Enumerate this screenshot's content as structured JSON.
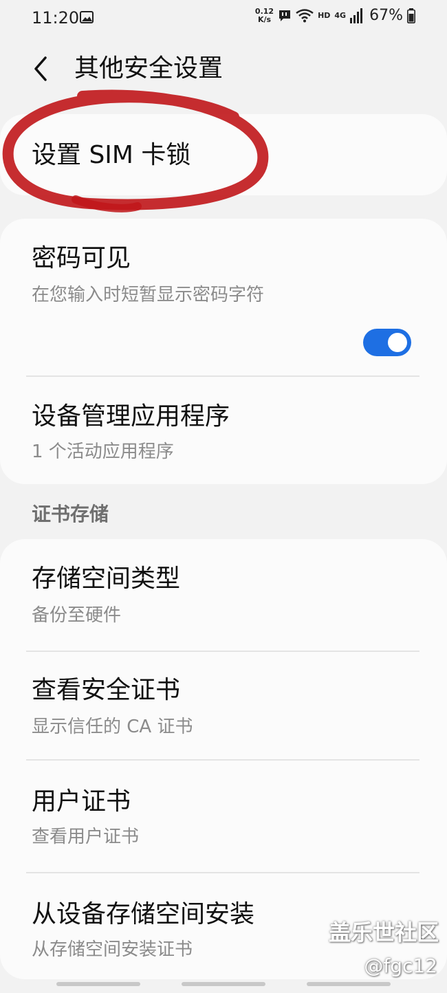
{
  "status_bar": {
    "time": "11:20",
    "net_speed_value": "0.12",
    "net_speed_unit": "K/s",
    "hd_label": "HD",
    "network_label": "4G",
    "battery": "67%",
    "icons": [
      "gallery-icon",
      "chat-icon",
      "wifi-icon",
      "signal-icon",
      "battery-icon"
    ]
  },
  "header": {
    "title": "其他安全设置"
  },
  "items": {
    "sim_lock": {
      "title": "设置 SIM 卡锁"
    },
    "password_visible": {
      "title": "密码可见",
      "subtitle": "在您输入时短暂显示密码字符",
      "toggle_on": true
    },
    "device_admin": {
      "title": "设备管理应用程序",
      "subtitle": "1 个活动应用程序"
    },
    "storage_type": {
      "title": "存储空间类型",
      "subtitle": "备份至硬件"
    },
    "view_certs": {
      "title": "查看安全证书",
      "subtitle": "显示信任的 CA 证书"
    },
    "user_certs": {
      "title": "用户证书",
      "subtitle": "查看用户证书"
    },
    "install_storage": {
      "title": "从设备存储空间安装",
      "subtitle": "从存储空间安装证书"
    }
  },
  "sections": {
    "cert_storage": "证书存储"
  },
  "watermark": {
    "site": "盖乐世社区",
    "handle": "@fgc12"
  },
  "colors": {
    "accent": "#1e6fe3",
    "annotation": "#c0161a",
    "background": "#f2f2f2",
    "card": "#fbfbfb"
  }
}
